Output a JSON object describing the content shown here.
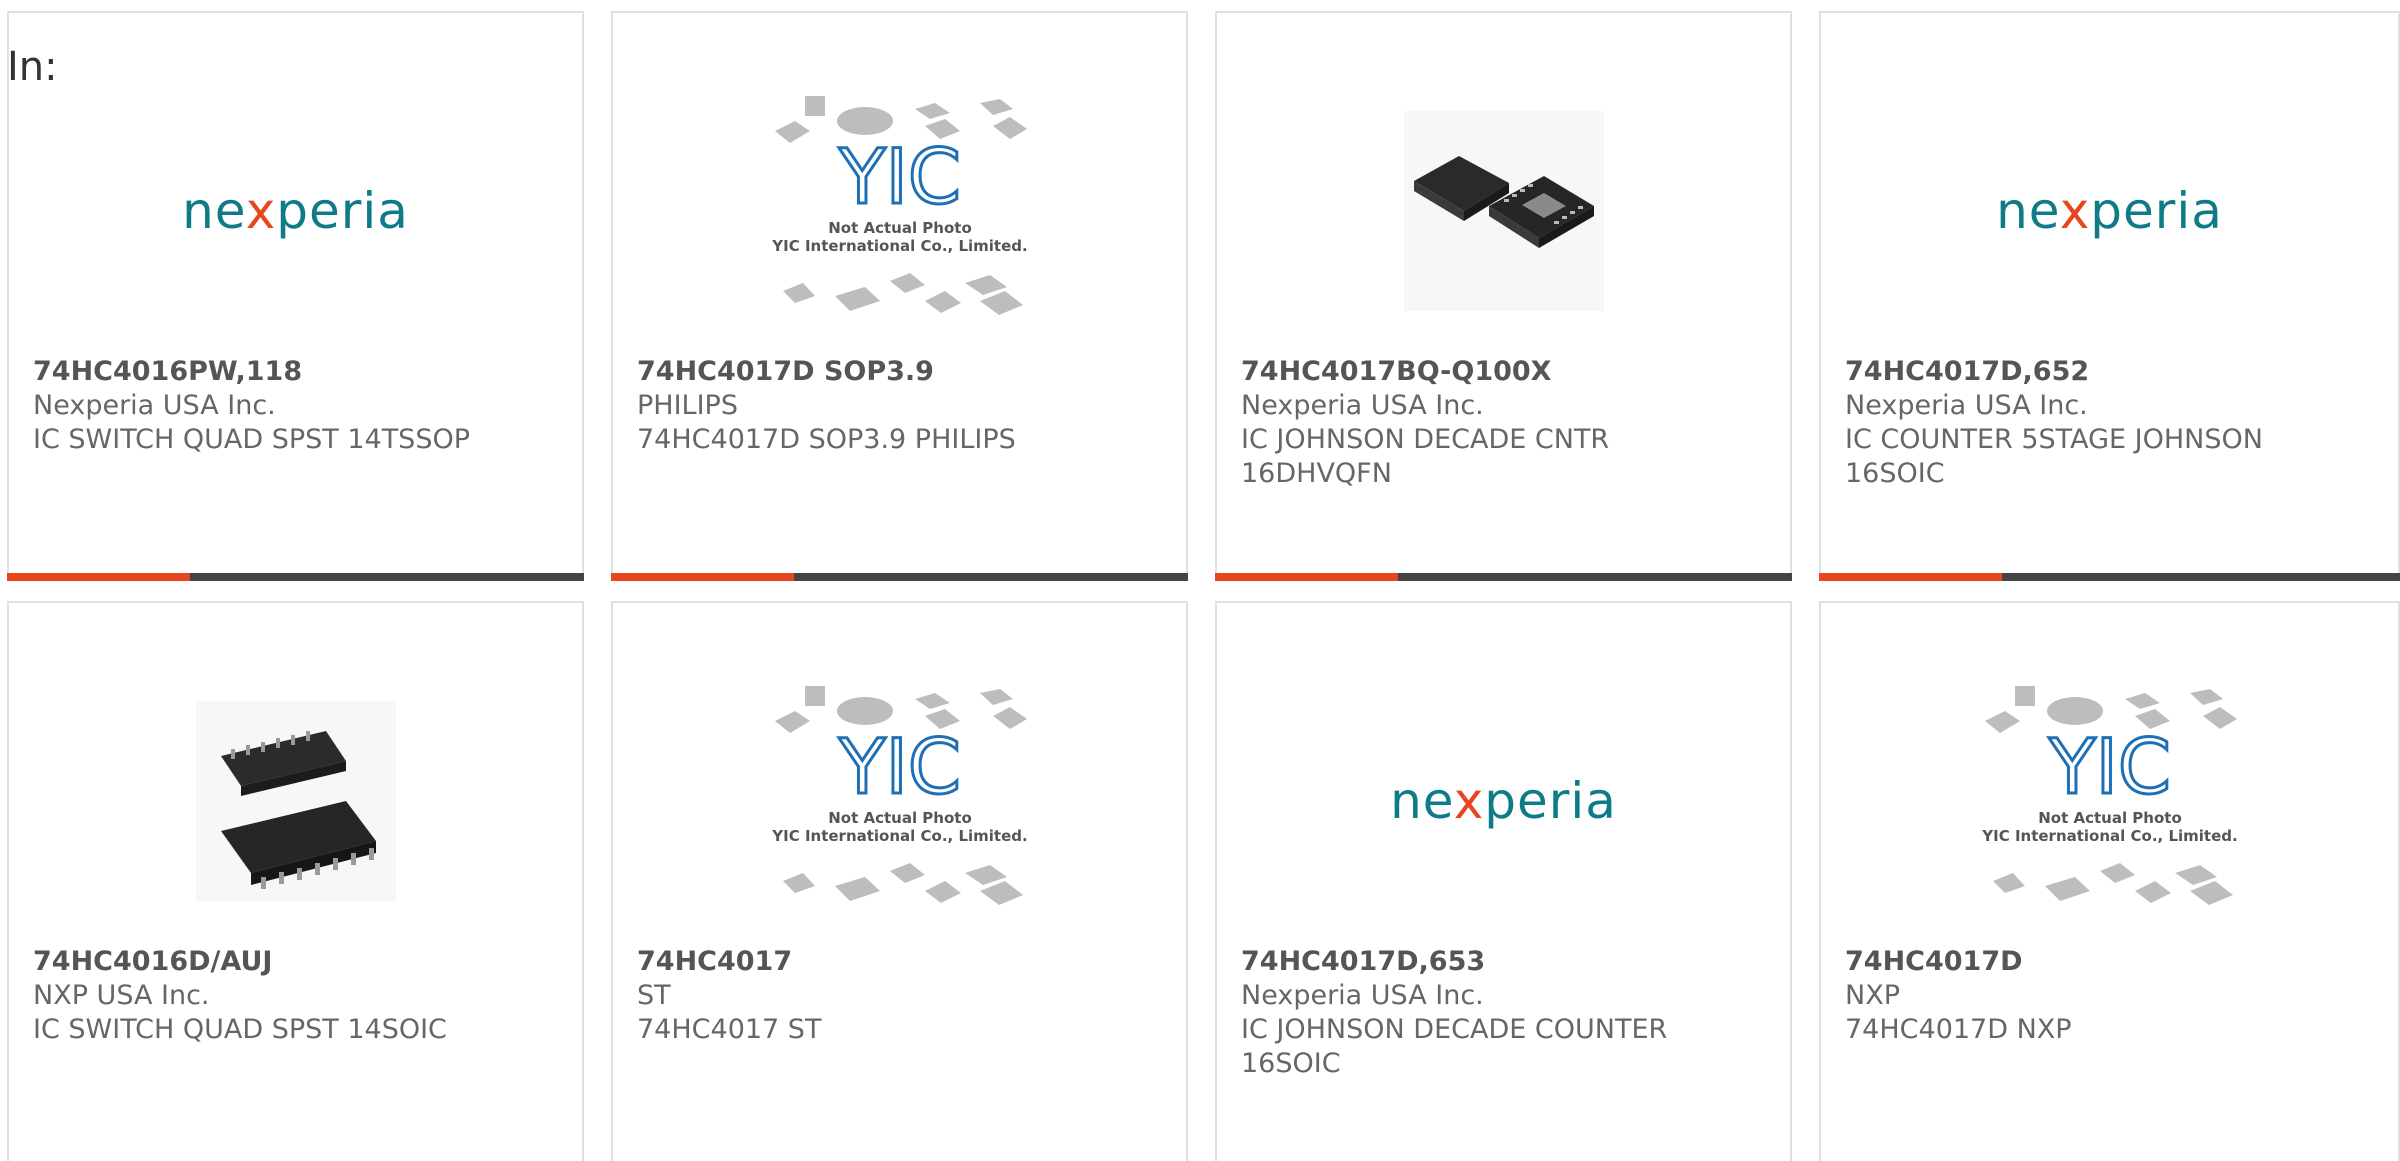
{
  "filter_label": "In:",
  "colors": {
    "accent": "#e8461e",
    "bar_dark": "#444444",
    "nexperia_teal": "#0e7b87",
    "yic_blue": "#1f6fb5"
  },
  "products": [
    {
      "part_number": "74HC4016PW,118",
      "manufacturer": "Nexperia USA Inc.",
      "description": "IC SWITCH QUAD SPST 14TSSOP",
      "image": "nexperia-logo"
    },
    {
      "part_number": "74HC4017D SOP3.9",
      "manufacturer": "PHILIPS",
      "description": "74HC4017D SOP3.9 PHILIPS",
      "image": "yic-placeholder"
    },
    {
      "part_number": "74HC4017BQ-Q100X",
      "manufacturer": "Nexperia USA Inc.",
      "description": "IC JOHNSON DECADE CNTR 16DHVQFN",
      "image": "qfn-chip-photo"
    },
    {
      "part_number": "74HC4017D,652",
      "manufacturer": "Nexperia USA Inc.",
      "description": "IC COUNTER 5STAGE JOHNSON 16SOIC",
      "image": "nexperia-logo"
    },
    {
      "part_number": "74HC4016D/AUJ",
      "manufacturer": "NXP USA Inc.",
      "description": "IC SWITCH QUAD SPST 14SOIC",
      "image": "soic-chip-photo"
    },
    {
      "part_number": "74HC4017",
      "manufacturer": "ST",
      "description": "74HC4017 ST",
      "image": "yic-placeholder"
    },
    {
      "part_number": "74HC4017D,653",
      "manufacturer": "Nexperia USA Inc.",
      "description": "IC JOHNSON DECADE COUNTER 16SOIC",
      "image": "nexperia-logo"
    },
    {
      "part_number": "74HC4017D",
      "manufacturer": "NXP",
      "description": "74HC4017D NXP",
      "image": "yic-placeholder"
    }
  ],
  "logos": {
    "nexperia": {
      "pre": "ne",
      "x": "x",
      "post": "peria"
    },
    "yic": {
      "mark": "YIC",
      "line1": "Not Actual Photo",
      "line2": "YIC International Co., Limited."
    }
  }
}
